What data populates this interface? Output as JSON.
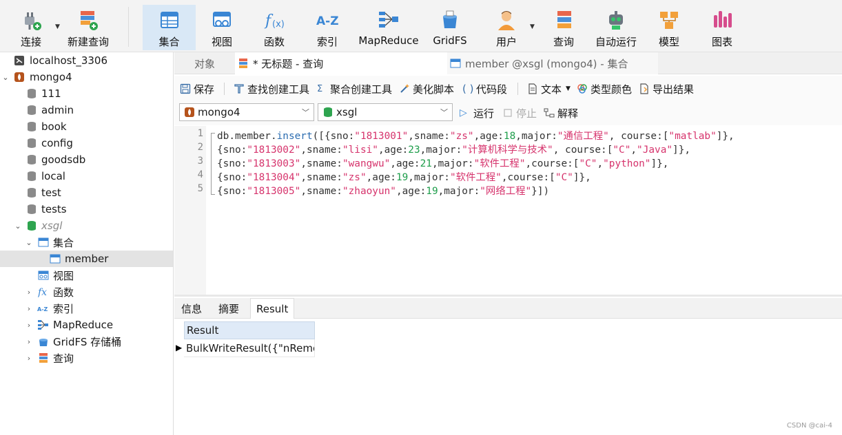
{
  "toolbar": {
    "items": [
      {
        "label": "连接",
        "icon": "plug-icon"
      },
      {
        "label": "新建查询",
        "icon": "new-query-icon"
      },
      {
        "label": "集合",
        "icon": "collection-icon"
      },
      {
        "label": "视图",
        "icon": "view-icon"
      },
      {
        "label": "函数",
        "icon": "function-icon"
      },
      {
        "label": "索引",
        "icon": "index-icon"
      },
      {
        "label": "MapReduce",
        "icon": "mapreduce-icon"
      },
      {
        "label": "GridFS",
        "icon": "gridfs-icon"
      },
      {
        "label": "用户",
        "icon": "user-icon"
      },
      {
        "label": "查询",
        "icon": "query-icon"
      },
      {
        "label": "自动运行",
        "icon": "robot-icon"
      },
      {
        "label": "模型",
        "icon": "model-icon"
      },
      {
        "label": "图表",
        "icon": "chart-icon"
      }
    ],
    "active": "集合"
  },
  "nav": {
    "items": [
      {
        "label": "localhost_3306",
        "icon": "mysql-connection-icon"
      },
      {
        "label": "mongo4",
        "icon": "mongodb-connection-icon"
      },
      {
        "label": "111",
        "icon": "database-icon"
      },
      {
        "label": "admin",
        "icon": "database-icon"
      },
      {
        "label": "book",
        "icon": "database-icon"
      },
      {
        "label": "config",
        "icon": "database-icon"
      },
      {
        "label": "goodsdb",
        "icon": "database-icon"
      },
      {
        "label": "local",
        "icon": "database-icon"
      },
      {
        "label": "test",
        "icon": "database-icon"
      },
      {
        "label": "tests",
        "icon": "database-icon"
      },
      {
        "label": "xsgl",
        "icon": "database-open-icon"
      },
      {
        "label": "集合",
        "icon": "collection-icon"
      },
      {
        "label": "member",
        "icon": "collection-icon"
      },
      {
        "label": "视图",
        "icon": "view-icon"
      },
      {
        "label": "函数",
        "icon": "function-icon"
      },
      {
        "label": "索引",
        "icon": "index-icon"
      },
      {
        "label": "MapReduce",
        "icon": "mapreduce-icon"
      },
      {
        "label": "GridFS 存储桶",
        "icon": "gridfs-icon"
      },
      {
        "label": "查询",
        "icon": "query-icon"
      }
    ],
    "selected": "member"
  },
  "tabs": [
    {
      "label": "对象"
    },
    {
      "label": "* 无标题 - 查询"
    },
    {
      "label": "member @xsgl (mongo4) - 集合"
    }
  ],
  "query_toolbar": {
    "save": "保存",
    "find_builder": "查找创建工具",
    "aggregate_builder": "聚合创建工具",
    "beautify": "美化脚本",
    "snippet": "代码段",
    "text": "文本",
    "type_color": "类型颜色",
    "export": "导出结果"
  },
  "selectors": {
    "connection": "mongo4",
    "database": "xsgl",
    "run": "运行",
    "stop": "停止",
    "explain": "解释"
  },
  "editor": {
    "lines": [
      "db.member.insert([{sno:\"1813001\",sname:\"zs\",age:18,major:\"通信工程\", course:[\"matlab\"]},",
      "{sno:\"1813002\",sname:\"lisi\",age:23,major:\"计算机科学与技术\", course:[\"C\",\"Java\"]},",
      "{sno:\"1813003\",sname:\"wangwu\",age:21,major:\"软件工程\",course:[\"C\",\"python\"]},",
      "{sno:\"1813004\",sname:\"zs\",age:19,major:\"软件工程\",course:[\"C\"]},",
      "{sno:\"1813005\",sname:\"zhaoyun\",age:19,major:\"网络工程\"}])"
    ],
    "line_numbers": [
      "1",
      "2",
      "3",
      "4",
      "5"
    ]
  },
  "result": {
    "tabs": [
      "信息",
      "摘要",
      "Result"
    ],
    "active_tab": "Result",
    "column": "Result",
    "row": "BulkWriteResult({\"nRemoved\""
  },
  "watermark": "CSDN @cai-4"
}
